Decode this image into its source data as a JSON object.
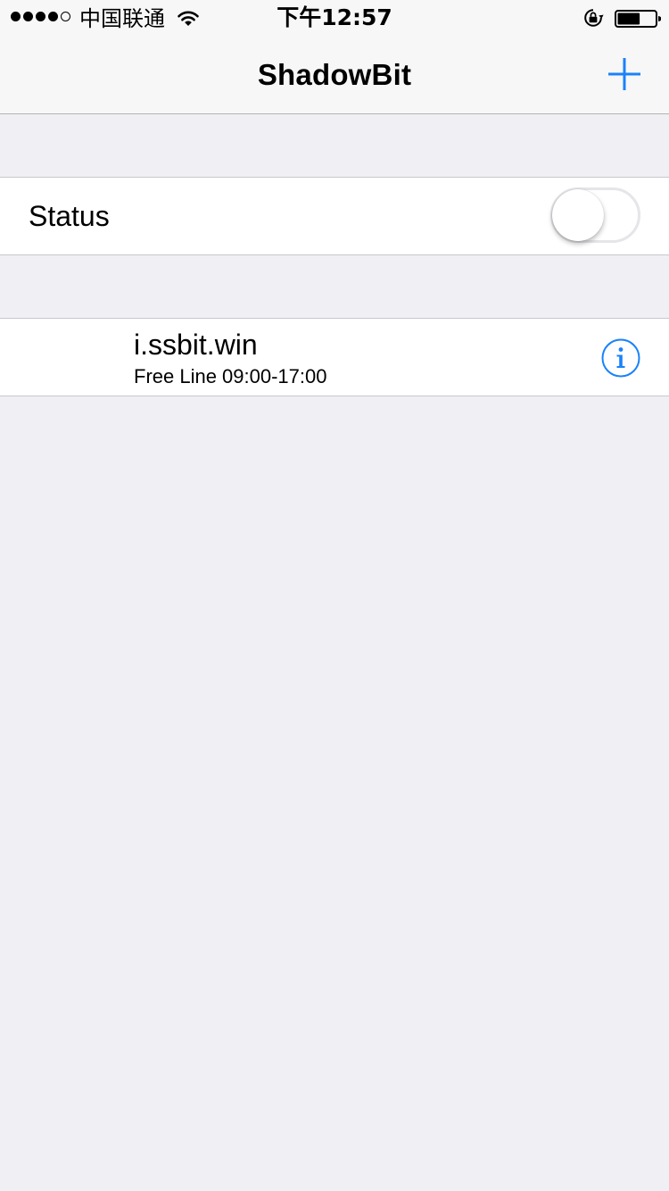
{
  "status_bar": {
    "signal_bars_filled": 4,
    "signal_bars_total": 5,
    "carrier": "中国联通",
    "time": "下午12:57",
    "battery_level_percent": 60
  },
  "nav": {
    "title": "ShadowBit",
    "add_icon": "plus-icon"
  },
  "status_row": {
    "label": "Status",
    "toggle_on": false
  },
  "servers": [
    {
      "host": "i.ssbit.win",
      "description": "Free Line 09:00-17:00",
      "info_icon": "info-circle-icon"
    }
  ],
  "colors": {
    "accent": "#1a82fb",
    "background": "#efeff4",
    "nav_background": "#f7f7f7",
    "separator": "#c8c7cc"
  }
}
